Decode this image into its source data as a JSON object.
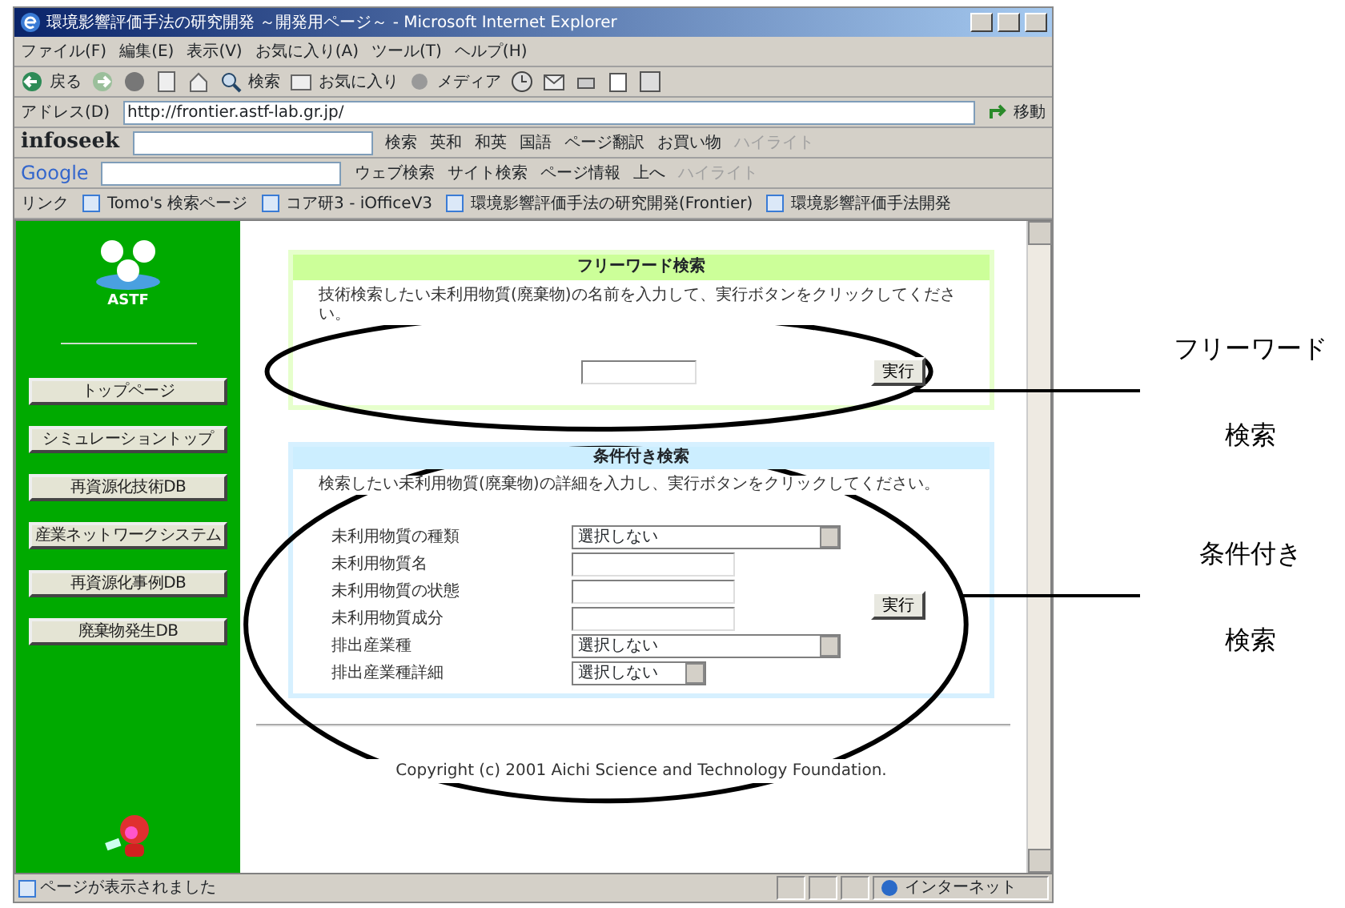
{
  "window": {
    "title": "環境影響評価手法の研究開発 ～開発用ページ～ - Microsoft Internet Explorer"
  },
  "menu": [
    "ファイル(F)",
    "編集(E)",
    "表示(V)",
    "お気に入り(A)",
    "ツール(T)",
    "ヘルプ(H)"
  ],
  "toolbar": [
    {
      "kind": "back",
      "label": "戻る"
    },
    {
      "kind": "forward"
    },
    {
      "kind": "stop"
    },
    {
      "kind": "refresh"
    },
    {
      "kind": "home"
    },
    {
      "kind": "search",
      "label": "検索"
    },
    {
      "kind": "favorites",
      "label": "お気に入り"
    },
    {
      "kind": "media",
      "label": "メディア"
    },
    {
      "kind": "history"
    },
    {
      "kind": "mail"
    },
    {
      "kind": "print"
    },
    {
      "kind": "edit"
    },
    {
      "kind": "discuss"
    }
  ],
  "address": {
    "label": "アドレス(D)",
    "value": "http://frontier.astf-lab.gr.jp/",
    "go": "移動"
  },
  "infoseek_bar": {
    "logo": "infoseek",
    "buttons": [
      {
        "label": "検索",
        "disabled": false
      },
      {
        "label": "英和",
        "disabled": false
      },
      {
        "label": "和英",
        "disabled": false
      },
      {
        "label": "国語",
        "disabled": false
      },
      {
        "label": "ページ翻訳",
        "disabled": false
      },
      {
        "label": "お買い物",
        "disabled": false
      },
      {
        "label": "ハイライト",
        "disabled": true
      }
    ]
  },
  "google_bar": {
    "logo": "Google",
    "buttons": [
      {
        "label": "ウェブ検索",
        "disabled": false
      },
      {
        "label": "サイト検索",
        "disabled": false
      },
      {
        "label": "ページ情報",
        "disabled": false
      },
      {
        "label": "上へ",
        "disabled": false
      },
      {
        "label": "ハイライト",
        "disabled": true
      }
    ]
  },
  "links_bar": {
    "label": "リンク",
    "items": [
      "Tomo's 検索ページ",
      "コア研3 - iOfficeV3",
      "環境影響評価手法の研究開発(Frontier)",
      "環境影響評価手法開発"
    ]
  },
  "sidebar": {
    "logo_text": "ASTF",
    "items": [
      "トップページ",
      "シミュレーショントップ",
      "再資源化技術DB",
      "産業ネットワークシステム",
      "再資源化事例DB",
      "廃棄物発生DB"
    ]
  },
  "free_search": {
    "title": "フリーワード検索",
    "description": "技術検索したい未利用物質(廃棄物)の名前を入力して、実行ボタンをクリックしてください。",
    "button": "実行"
  },
  "condition_search": {
    "title": "条件付き検索",
    "description": "検索したい未利用物質(廃棄物)の詳細を入力し、実行ボタンをクリックしてください。",
    "button": "実行",
    "fields": [
      {
        "label": "未利用物質の種類",
        "kind": "dropdown",
        "value": "選択しない"
      },
      {
        "label": "未利用物質名",
        "kind": "text"
      },
      {
        "label": "未利用物質の状態",
        "kind": "text"
      },
      {
        "label": "未利用物質成分",
        "kind": "text"
      },
      {
        "label": "排出産業種",
        "kind": "dropdown",
        "value": "選択しない"
      },
      {
        "label": "排出産業種詳細",
        "kind": "short-dropdown",
        "value": "選択しない"
      }
    ]
  },
  "copyright": "Copyright (c) 2001 Aichi Science and Technology Foundation.",
  "status_bar": {
    "text": "ページが表示されました",
    "zone": "インターネット"
  },
  "annotations": [
    {
      "lines": [
        "フリーワード",
        "検索"
      ]
    },
    {
      "lines": [
        "条件付き",
        "検索"
      ]
    }
  ]
}
